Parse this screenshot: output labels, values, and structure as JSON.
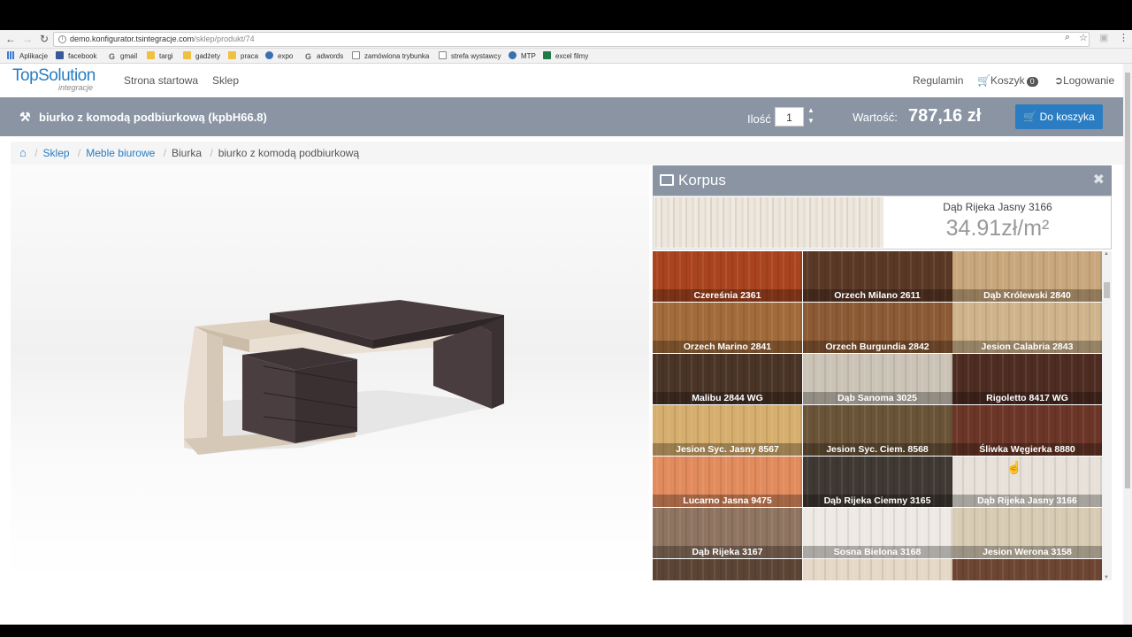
{
  "browser": {
    "url_host": "demo.konfigurator.tsintegracje.com",
    "url_path": "/sklep/produkt/74",
    "bookmarks": [
      {
        "label": "Aplikacje",
        "icon": "apps-grid-icon"
      },
      {
        "label": "facebook",
        "icon": "facebook-icon"
      },
      {
        "label": "gmail",
        "icon": "google-icon"
      },
      {
        "label": "targi",
        "icon": "folder-icon"
      },
      {
        "label": "gadżety",
        "icon": "folder-icon"
      },
      {
        "label": "praca",
        "icon": "folder-icon"
      },
      {
        "label": "expo",
        "icon": "globe-icon"
      },
      {
        "label": "adwords",
        "icon": "google-icon"
      },
      {
        "label": "zamówiona trybunka",
        "icon": "document-icon"
      },
      {
        "label": "strefa wystawcy",
        "icon": "document-icon"
      },
      {
        "label": "MTP",
        "icon": "globe-icon"
      },
      {
        "label": "excel filmy",
        "icon": "spreadsheet-icon"
      }
    ]
  },
  "header": {
    "logo_top": "TopSolution",
    "logo_bottom": "integracje",
    "nav": [
      "Strona startowa",
      "Sklep"
    ],
    "terms": "Regulamin",
    "cart_label": "Koszyk",
    "cart_count": "0",
    "login": "Logowanie"
  },
  "product": {
    "title": "biurko z komodą podbiurkową (kpbH66.8)",
    "qty_label": "Ilość",
    "qty_value": "1",
    "value_label": "Wartość:",
    "value_amount": "787,16 zł",
    "add_to_cart": "Do koszyka"
  },
  "breadcrumb": [
    "Sklep",
    "Meble biurowe",
    "Biurka",
    "biurko z komodą podbiurkową"
  ],
  "panel": {
    "title": "Korpus",
    "selected_name": "Dąb Rijeka Jasny 3166",
    "selected_price": "34.91zł/m²",
    "materials": [
      {
        "name": "Czereśnia 2361",
        "color": "#a9441e"
      },
      {
        "name": "Orzech Milano 2611",
        "color": "#5b3826"
      },
      {
        "name": "Dąb Królewski 2840",
        "color": "#c9a77c"
      },
      {
        "name": "Orzech Marino 2841",
        "color": "#a26b3a"
      },
      {
        "name": "Orzech Burgundia 2842",
        "color": "#8c5a34"
      },
      {
        "name": "Jesion Calabria 2843",
        "color": "#cfb48b"
      },
      {
        "name": "Malibu 2844 WG",
        "color": "#4a3426"
      },
      {
        "name": "Dąb Sanoma 3025",
        "color": "#cbc3b6"
      },
      {
        "name": "Rigoletto 8417 WG",
        "color": "#4e2c22"
      },
      {
        "name": "Jesion Syc. Jasny 8567",
        "color": "#d6ae6e"
      },
      {
        "name": "Jesion Syc. Ciem. 8568",
        "color": "#6a5438"
      },
      {
        "name": "Śliwka Węgierka 8880",
        "color": "#6b3628"
      },
      {
        "name": "Lucarno Jasna 9475",
        "color": "#e28b5d"
      },
      {
        "name": "Dąb Rijeka Ciemny 3165",
        "color": "#3f3833"
      },
      {
        "name": "Dąb Rijeka Jasny 3166",
        "color": "#e7e1d9"
      },
      {
        "name": "Dąb Rijeka 3167",
        "color": "#8e7461"
      },
      {
        "name": "Sosna Bielona 3168",
        "color": "#eee9e4"
      },
      {
        "name": "Jesion Werona 3158",
        "color": "#d8cbb4"
      },
      {
        "name": "",
        "color": "#5c4434"
      },
      {
        "name": "",
        "color": "#e6d8c6"
      },
      {
        "name": "",
        "color": "#6d4532"
      }
    ]
  }
}
